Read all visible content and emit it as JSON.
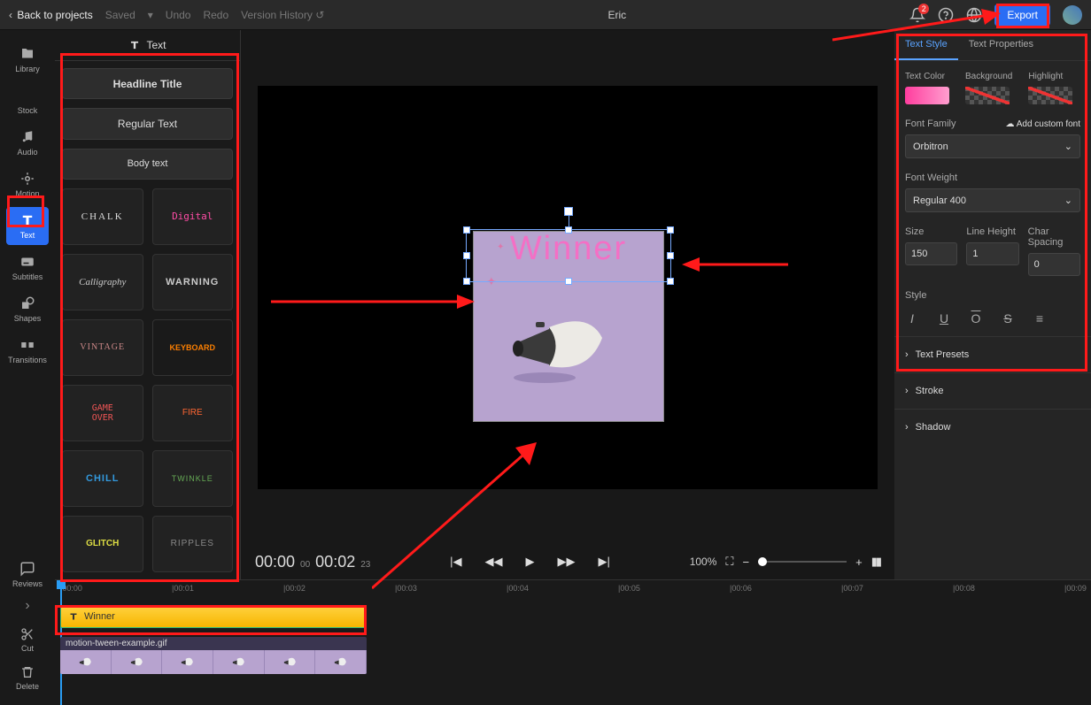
{
  "topbar": {
    "back": "Back to projects",
    "saved": "Saved",
    "undo": "Undo",
    "redo": "Redo",
    "version_history": "Version History",
    "project_name": "Eric",
    "export": "Export",
    "notif_count": "2"
  },
  "rail": {
    "library": "Library",
    "stock": "Stock",
    "audio": "Audio",
    "motion": "Motion",
    "text": "Text",
    "subtitles": "Subtitles",
    "shapes": "Shapes",
    "transitions": "Transitions",
    "reviews": "Reviews",
    "cut": "Cut",
    "delete": "Delete"
  },
  "text_panel": {
    "title": "Text",
    "headline": "Headline Title",
    "regular": "Regular Text",
    "body": "Body text",
    "presets": {
      "chalk": "CHALK",
      "digital": "Digital",
      "calligraphy": "Calligraphy",
      "warning": "WARNING",
      "vintage": "VINTAGE",
      "keyboard": "KEYBOARD",
      "gameover": "GAME\nOVER",
      "fire": "FIRE",
      "chill": "CHILL",
      "twinkle": "TWINKLE",
      "glitch": "GLITCH",
      "ripples": "RIPPLES"
    }
  },
  "canvas": {
    "text_value": "Winner"
  },
  "player": {
    "current": "00:00",
    "current_frames": "00",
    "total": "00:02",
    "total_frames": "23",
    "zoom_pct": "100%"
  },
  "right": {
    "tab_style": "Text Style",
    "tab_props": "Text Properties",
    "text_color": "Text Color",
    "background": "Background",
    "highlight": "Highlight",
    "font_family_label": "Font Family",
    "add_custom": "Add custom font",
    "font_family_value": "Orbitron",
    "font_weight_label": "Font Weight",
    "font_weight_value": "Regular 400",
    "size_label": "Size",
    "size_value": "150",
    "lh_label": "Line Height",
    "lh_value": "1",
    "cs_label": "Char Spacing",
    "cs_value": "0",
    "style_label": "Style",
    "acc_presets": "Text Presets",
    "acc_stroke": "Stroke",
    "acc_shadow": "Shadow"
  },
  "timeline": {
    "ticks": [
      "|00:00",
      "|00:01",
      "|00:02",
      "|00:03",
      "|00:04",
      "|00:05",
      "|00:06",
      "|00:07",
      "|00:08",
      "|00:09"
    ],
    "text_clip": "Winner",
    "video_clip": "motion-tween-example.gif"
  }
}
